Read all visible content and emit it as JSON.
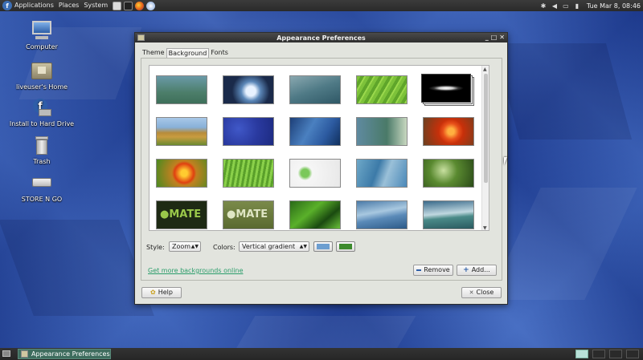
{
  "top_panel": {
    "menus": [
      "Applications",
      "Places",
      "System"
    ],
    "clock": "Tue Mar 8, 08:46"
  },
  "desktop_icons": [
    {
      "label": "Computer",
      "icon": "computer-icon"
    },
    {
      "label": "liveuser's Home",
      "icon": "home-folder-icon"
    },
    {
      "label": "Install to Hard Drive",
      "icon": "install-icon"
    },
    {
      "label": "Trash",
      "icon": "trash-icon"
    },
    {
      "label": "STORE N GO",
      "icon": "drive-icon"
    }
  ],
  "window": {
    "title": "Appearance Preferences",
    "tabs": [
      "Theme",
      "Background",
      "Fonts"
    ],
    "active_tab": "Background",
    "style_label": "Style:",
    "style_value": "Zoom",
    "colors_label": "Colors:",
    "colors_value": "Vertical gradient",
    "primary_color": "#6c9ed0",
    "secondary_color": "#3c8a2c",
    "link_text": "Get more backgrounds online",
    "remove_label": "Remove",
    "add_label": "Add...",
    "help_label": "Help",
    "close_label": "Close",
    "wallpapers": [
      "blue-green-gradient",
      "water-drop",
      "misty-blue",
      "green-leaf",
      "sombrero-galaxy",
      "grass-sky",
      "blue-texture-selected",
      "blue-drops",
      "blue-green-bokeh",
      "orange-flower",
      "orange-flower-2",
      "green-grass",
      "white-logo",
      "blue-swirl",
      "leaf-sky",
      "mate-dark",
      "mate-olive",
      "green-leaves",
      "blue-waves",
      "blue-green-waves"
    ],
    "selected_wallpaper": "blue-texture-selected"
  },
  "taskbar": {
    "window_button": "Appearance Preferences"
  }
}
